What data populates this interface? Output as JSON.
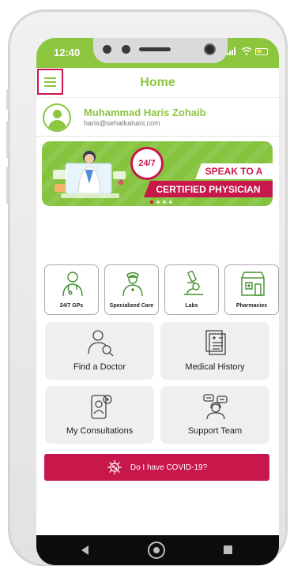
{
  "status_bar": {
    "time": "12:40"
  },
  "header": {
    "title": "Home",
    "menu_icon": "hamburger-menu-icon"
  },
  "user": {
    "name": "Muhammad Haris Zohaib",
    "email": "haris@sehatkahani.com",
    "avatar_icon": "user-avatar-icon"
  },
  "banner": {
    "badge": "24/7",
    "line1": "SPEAK TO A",
    "line2": "CERTIFIED PHYSICIAN",
    "pages": 4,
    "active_page": 1
  },
  "services": [
    {
      "label": "24/7 GPs",
      "icon": "doctor-icon"
    },
    {
      "label": "Specialized Care",
      "icon": "nurse-icon"
    },
    {
      "label": "Labs",
      "icon": "microscope-icon"
    },
    {
      "label": "Pharmacies",
      "icon": "pharmacy-icon"
    }
  ],
  "cards": [
    {
      "label": "Find a Doctor",
      "icon": "search-doctor-icon"
    },
    {
      "label": "Medical History",
      "icon": "medical-records-icon"
    },
    {
      "label": "My Consultations",
      "icon": "video-consultation-icon"
    },
    {
      "label": "Support Team",
      "icon": "support-agent-icon"
    }
  ],
  "covid": {
    "label": "Do I have COVID-19?",
    "icon": "virus-icon"
  },
  "nav": {
    "back": "back-icon",
    "home": "home-icon",
    "recent": "recent-apps-icon"
  },
  "colors": {
    "primary_green": "#8cc63e",
    "accent_red": "#c8174a",
    "card_bg": "#efefef"
  }
}
